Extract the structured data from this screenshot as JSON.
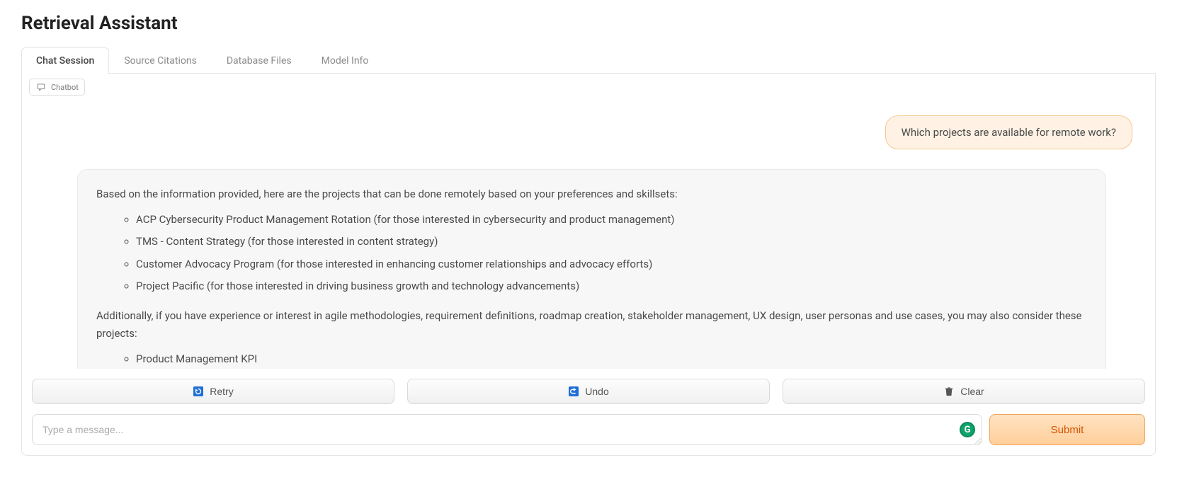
{
  "page_title": "Retrieval Assistant",
  "tabs": [
    {
      "label": "Chat Session",
      "active": true
    },
    {
      "label": "Source Citations",
      "active": false
    },
    {
      "label": "Database Files",
      "active": false
    },
    {
      "label": "Model Info",
      "active": false
    }
  ],
  "chatbot_badge": "Chatbot",
  "conversation": {
    "user_message": "Which projects are available for remote work?",
    "bot_intro": "Based on the information provided, here are the projects that can be done remotely based on your preferences and skillsets:",
    "bot_list_a": [
      "ACP Cybersecurity Product Management Rotation (for those interested in cybersecurity and product management)",
      "TMS - Content Strategy (for those interested in content strategy)",
      "Customer Advocacy Program (for those interested in enhancing customer relationships and advocacy efforts)",
      "Project Pacific (for those interested in driving business growth and technology advancements)"
    ],
    "bot_middle": "Additionally, if you have experience or interest in agile methodologies, requirement definitions, roadmap creation, stakeholder management, UX design, user personas and use cases, you may also consider these projects:",
    "bot_list_b": [
      "Product Management KPI"
    ]
  },
  "actions": {
    "retry": "Retry",
    "undo": "Undo",
    "clear": "Clear"
  },
  "input": {
    "placeholder": "Type a message...",
    "value": ""
  },
  "submit_label": "Submit",
  "grammarly_badge": "G",
  "colors": {
    "accent_orange": "#e67e22",
    "user_bubble_bg": "#fff2e4",
    "user_bubble_border": "#f3c892",
    "bot_bubble_bg": "#f7f7f7"
  }
}
